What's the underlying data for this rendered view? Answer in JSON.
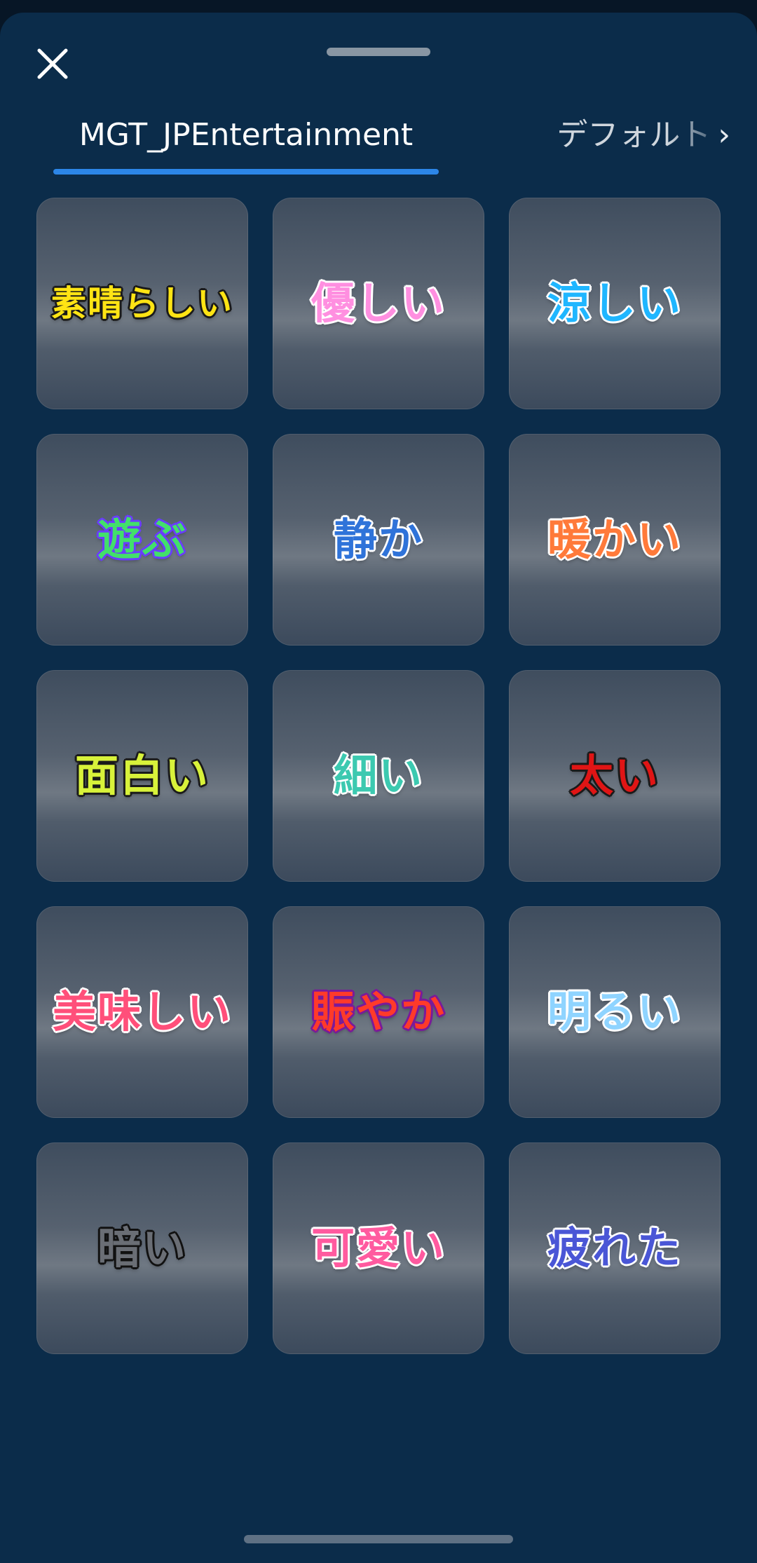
{
  "header": {
    "close_icon": "close-x-icon"
  },
  "tabs": {
    "active_label": "MGT_JPEntertainment",
    "next_label": "デフォルト",
    "next_chevron": "›",
    "accent": "#2c86e8"
  },
  "stickers": [
    {
      "text": "素晴らしい",
      "fill": "#ffe414",
      "outline": "#1a1a1a"
    },
    {
      "text": "優しい",
      "fill": "#ff8fe0",
      "outline": "#ffffff"
    },
    {
      "text": "涼しい",
      "fill": "#1fb6ff",
      "outline": "#ffffff"
    },
    {
      "text": "遊ぶ",
      "fill": "#42e06a",
      "outline": "#6a3cff"
    },
    {
      "text": "静か",
      "fill": "#2f73d9",
      "outline": "#ffffff"
    },
    {
      "text": "暖かい",
      "fill": "#ff7a3a",
      "outline": "#ffffff"
    },
    {
      "text": "面白い",
      "fill": "#d8f23a",
      "outline": "#1a1a1a"
    },
    {
      "text": "細い",
      "fill": "#3cc9b0",
      "outline": "#ffffff"
    },
    {
      "text": "太い",
      "fill": "#e01515",
      "outline": "#1a1a1a"
    },
    {
      "text": "美味しい",
      "fill": "#ff4f7a",
      "outline": "#ffffff"
    },
    {
      "text": "賑やか",
      "fill": "#ff3a2a",
      "outline": "#7a1a9a"
    },
    {
      "text": "明るい",
      "fill": "#8fd4ff",
      "outline": "#ffffff"
    },
    {
      "text": "暗い",
      "fill": "#6a6e75",
      "outline": "#111111"
    },
    {
      "text": "可愛い",
      "fill": "#ff5a9f",
      "outline": "#ffffff"
    },
    {
      "text": "疲れた",
      "fill": "#4a56d6",
      "outline": "#ffffff"
    }
  ]
}
